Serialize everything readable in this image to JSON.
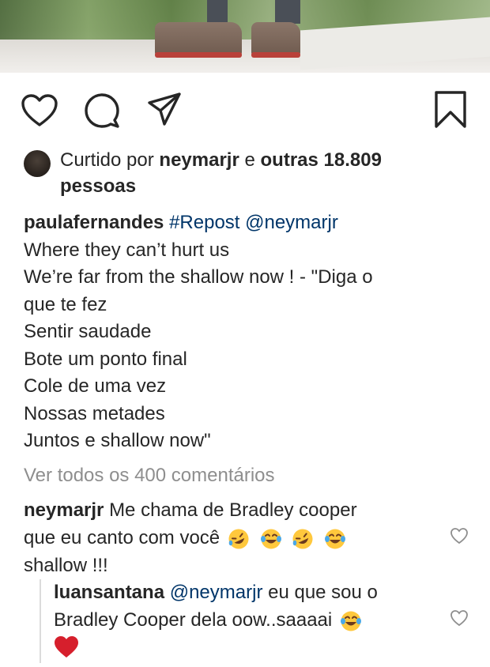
{
  "post": {
    "likes_prefix": "Curtido por",
    "likes_user": "neymarjr",
    "likes_connector": "e",
    "likes_others": "outras 18.809",
    "likes_suffix": "pessoas"
  },
  "caption": {
    "username": "paulafernandes",
    "hashtag": "#Repost",
    "mention": "@neymarjr",
    "lines": [
      "Where they can’t hurt us",
      "We’re far from the shallow now ! - \"Diga o",
      "que te fez",
      "Sentir saudade",
      "Bote um ponto final",
      "Cole de uma vez",
      "Nossas metades",
      "Juntos e shallow now\""
    ]
  },
  "view_all": "Ver todos os 400 comentários",
  "comments": [
    {
      "username": "neymarjr",
      "line1": "Me chama de Bradley cooper",
      "line2": "que eu canto com você",
      "line3": "shallow !!!"
    }
  ],
  "reply": {
    "username": "luansantana",
    "mention": "@neymarjr",
    "line1": "eu que sou o",
    "line2": "Bradley Cooper dela oow..saaaai"
  },
  "icons": [
    "heart-icon",
    "comment-icon",
    "share-icon",
    "bookmark-icon",
    "avatar",
    "rofl-emoji",
    "joy-emoji",
    "red-heart-emoji"
  ],
  "colors": {
    "text": "#262626",
    "link": "#003569",
    "muted": "#8e8e8e",
    "heart": "#d61f2c"
  }
}
